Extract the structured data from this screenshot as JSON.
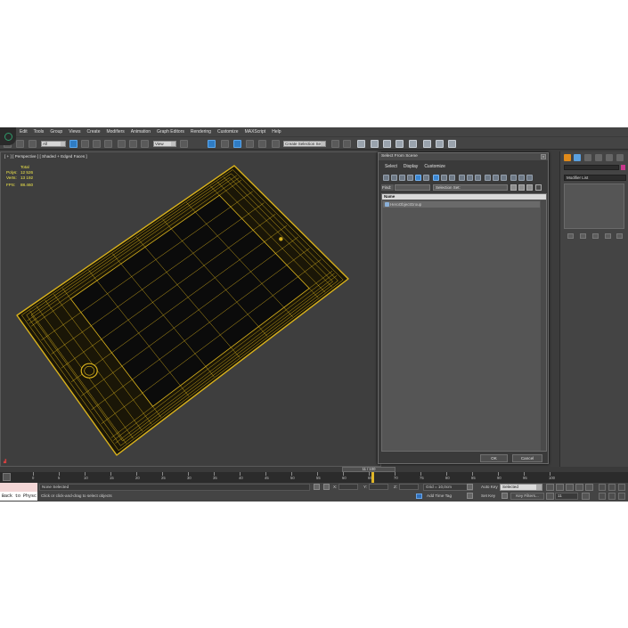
{
  "window": {
    "menu": [
      "Edit",
      "Tools",
      "Group",
      "Views",
      "Create",
      "Modifiers",
      "Animation",
      "Graph Editors",
      "Rendering",
      "Customize",
      "MAXScript",
      "Help"
    ]
  },
  "toolbar": {
    "selection_filter": "All",
    "ref_coord": "View",
    "named_selection": "Create Selection Se"
  },
  "viewport": {
    "label": "[ + ] [ Perspective ] [ Shaded + Edged Faces ]",
    "stats": {
      "total_label": "Total",
      "polys_label": "Polys:",
      "polys_value": "12 526",
      "verts_label": "Verts:",
      "verts_value": "13 192",
      "fps_label": "FPS:",
      "fps_value": "88.460"
    },
    "wire_color": "#d9b21c",
    "screen_color": "#0b0b0b"
  },
  "command_panel": {
    "modifier_list": "Modifier List",
    "swatch_color": "#c8368b"
  },
  "dialog": {
    "title": "Select From Scene",
    "close": "x",
    "menu": [
      "Select",
      "Display",
      "Customize"
    ],
    "find_label": "Find:",
    "find_value": "",
    "selection_set": "Selection Set:",
    "column_name": "Name",
    "items": [
      "HeroObjectGroup"
    ],
    "ok": "OK",
    "cancel": "Cancel"
  },
  "timeline": {
    "frame_display": "11 / 100",
    "current_frame": 11,
    "total_frames": 100,
    "tick_labels": [
      "0",
      "5",
      "10",
      "15",
      "20",
      "25",
      "30",
      "35",
      "40",
      "45",
      "50",
      "55",
      "60",
      "65",
      "70",
      "75",
      "80",
      "85",
      "90",
      "95",
      "100"
    ]
  },
  "status": {
    "maxscript_output": "Back to Physc",
    "selection": "None Selected",
    "prompt": "Click or click-and-drag to select objects",
    "x_label": "X:",
    "y_label": "Y:",
    "z_label": "Z:",
    "x_value": "",
    "y_value": "",
    "z_value": "",
    "grid": "Grid = 10,0cm",
    "add_time_tag": "Add Time Tag",
    "auto_key": "Auto Key",
    "set_key": "Set Key",
    "key_mode": "Selected",
    "key_filters": "Key Filters...",
    "current_frame": "11"
  }
}
